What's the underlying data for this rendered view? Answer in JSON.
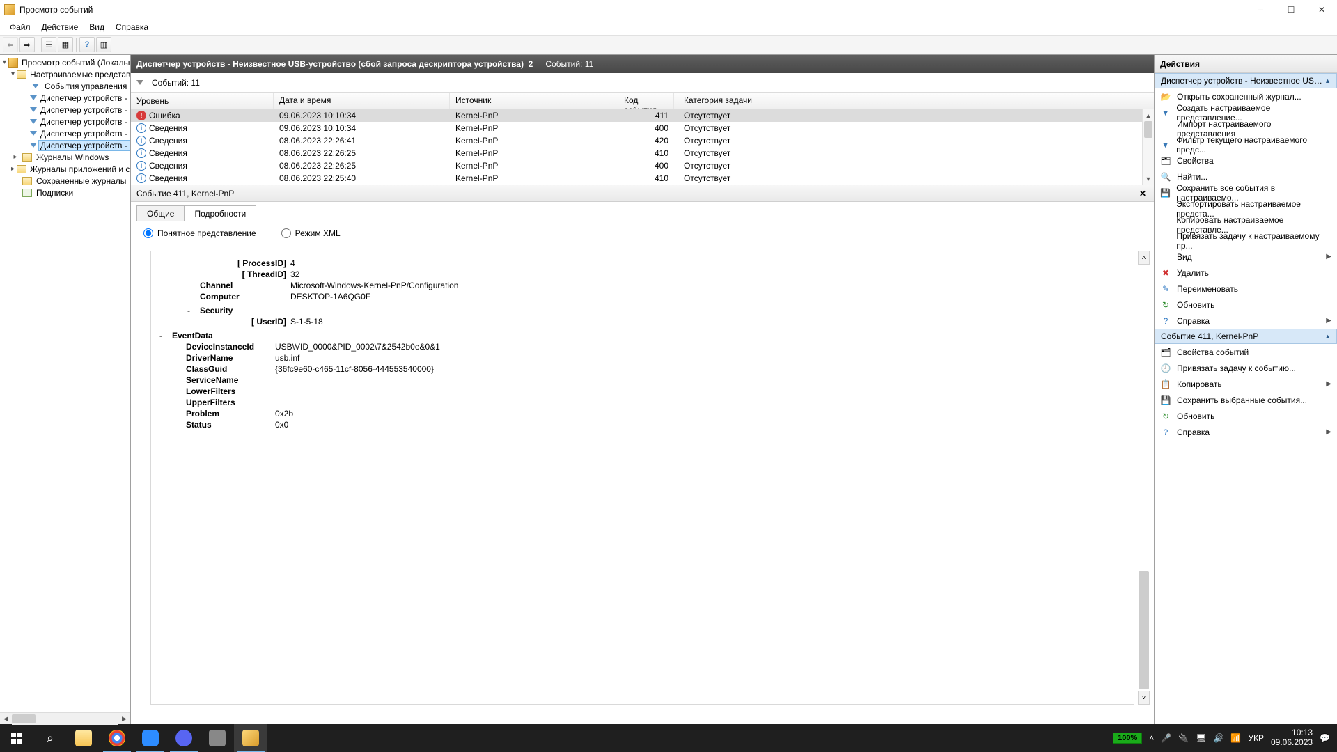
{
  "titlebar": {
    "title": "Просмотр событий"
  },
  "menubar": [
    "Файл",
    "Действие",
    "Вид",
    "Справка"
  ],
  "tree": {
    "root": "Просмотр событий (Локальный)",
    "custom_views": "Настраиваемые представления",
    "custom_children": [
      "События управления",
      "Диспетчер устройств - Н",
      "Диспетчер устройств - Н",
      "Диспетчер устройств - С",
      "Диспетчер устройств - С",
      "Диспетчер устройств - Н"
    ],
    "windows_logs": "Журналы Windows",
    "app_service_logs": "Журналы приложений и слу",
    "saved_logs": "Сохраненные журналы",
    "subscriptions": "Подписки"
  },
  "viewheader": {
    "title": "Диспетчер устройств - Неизвестное USB-устройство (сбой запроса дескриптора устройства)_2",
    "count": "Событий: 11"
  },
  "filterbar": {
    "text": "Событий: 11"
  },
  "grid": {
    "headers": {
      "level": "Уровень",
      "date": "Дата и время",
      "src": "Источник",
      "code": "Код события",
      "cat": "Категория задачи"
    },
    "rows": [
      {
        "level": "Ошибка",
        "icon": "err",
        "date": "09.06.2023 10:10:34",
        "src": "Kernel-PnP",
        "code": "411",
        "cat": "Отсутствует",
        "sel": true
      },
      {
        "level": "Сведения",
        "icon": "info",
        "date": "09.06.2023 10:10:34",
        "src": "Kernel-PnP",
        "code": "400",
        "cat": "Отсутствует"
      },
      {
        "level": "Сведения",
        "icon": "info",
        "date": "08.06.2023 22:26:41",
        "src": "Kernel-PnP",
        "code": "420",
        "cat": "Отсутствует"
      },
      {
        "level": "Сведения",
        "icon": "info",
        "date": "08.06.2023 22:26:25",
        "src": "Kernel-PnP",
        "code": "410",
        "cat": "Отсутствует"
      },
      {
        "level": "Сведения",
        "icon": "info",
        "date": "08.06.2023 22:26:25",
        "src": "Kernel-PnP",
        "code": "400",
        "cat": "Отсутствует"
      },
      {
        "level": "Сведения",
        "icon": "info",
        "date": "08.06.2023 22:25:40",
        "src": "Kernel-PnP",
        "code": "410",
        "cat": "Отсутствует"
      }
    ]
  },
  "detailheader": {
    "title": "Событие 411, Kernel-PnP"
  },
  "tabs": {
    "general": "Общие",
    "details": "Подробности"
  },
  "radios": {
    "friendly": "Понятное представление",
    "xml": "Режим XML"
  },
  "detail": {
    "processid_k": "[ ProcessID]",
    "processid_v": "4",
    "threadid_k": "[ ThreadID]",
    "threadid_v": "32",
    "channel_k": "Channel",
    "channel_v": "Microsoft-Windows-Kernel-PnP/Configuration",
    "computer_k": "Computer",
    "computer_v": "DESKTOP-1A6QG0F",
    "security_k": "Security",
    "userid_k": "[ UserID]",
    "userid_v": "S-1-5-18",
    "eventdata_k": "EventData",
    "devinst_k": "DeviceInstanceId",
    "devinst_v": "USB\\VID_0000&PID_0002\\7&2542b0e&0&1",
    "driver_k": "DriverName",
    "driver_v": "usb.inf",
    "classguid_k": "ClassGuid",
    "classguid_v": "{36fc9e60-c465-11cf-8056-444553540000}",
    "servname_k": "ServiceName",
    "servname_v": "",
    "lowerf_k": "LowerFilters",
    "lowerf_v": "",
    "upperf_k": "UpperFilters",
    "upperf_v": "",
    "problem_k": "Problem",
    "problem_v": "0x2b",
    "status_k": "Status",
    "status_v": "0x0"
  },
  "actions": {
    "heading": "Действия",
    "section1": "Диспетчер устройств - Неизвестное USB-уст...",
    "group1": [
      {
        "icon": "📂",
        "label": "Открыть сохраненный журнал..."
      },
      {
        "icon": "▼",
        "label": "Создать настраиваемое представление...",
        "iconcolor": "#3a7ab8"
      },
      {
        "icon": "",
        "label": "Импорт настраиваемого представления"
      },
      {
        "icon": "▼",
        "label": "Фильтр текущего настраиваемого предс...",
        "iconcolor": "#3a7ab8"
      },
      {
        "icon": "🗂",
        "label": "Свойства"
      },
      {
        "icon": "🔍",
        "label": "Найти..."
      },
      {
        "icon": "💾",
        "label": "Сохранить все события в настраиваемо..."
      },
      {
        "icon": "",
        "label": "Экспортировать настраиваемое предста..."
      },
      {
        "icon": "",
        "label": "Копировать настраиваемое представле..."
      },
      {
        "icon": "",
        "label": "Привязать задачу к настраиваемому пр..."
      },
      {
        "icon": "",
        "label": "Вид",
        "arrow": true
      },
      {
        "icon": "✖",
        "label": "Удалить",
        "iconcolor": "#d03030"
      },
      {
        "icon": "✎",
        "label": "Переименовать",
        "iconcolor": "#2e78c2"
      },
      {
        "icon": "↻",
        "label": "Обновить",
        "iconcolor": "#2a8a2a"
      },
      {
        "icon": "?",
        "label": "Справка",
        "iconcolor": "#2e78c2",
        "arrow": true
      }
    ],
    "section2": "Событие 411, Kernel-PnP",
    "group2": [
      {
        "icon": "🗂",
        "label": "Свойства событий"
      },
      {
        "icon": "🕘",
        "label": "Привязать задачу к событию..."
      },
      {
        "icon": "📋",
        "label": "Копировать",
        "arrow": true
      },
      {
        "icon": "💾",
        "label": "Сохранить выбранные события..."
      },
      {
        "icon": "↻",
        "label": "Обновить",
        "iconcolor": "#2a8a2a"
      },
      {
        "icon": "?",
        "label": "Справка",
        "iconcolor": "#2e78c2",
        "arrow": true
      }
    ]
  },
  "tray": {
    "battery": "100%",
    "lang": "УКР",
    "time": "10:13",
    "date": "09.06.2023"
  }
}
